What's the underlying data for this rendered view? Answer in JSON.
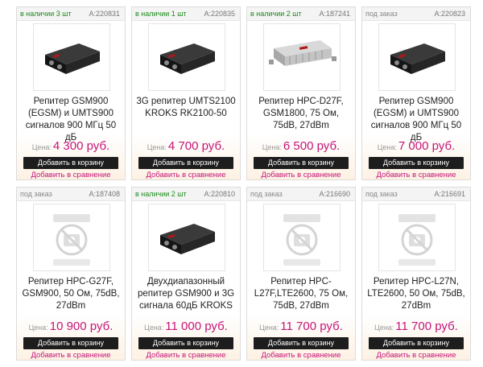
{
  "products": [
    {
      "stock": "в наличии 3 шт",
      "in_stock": true,
      "article": "A:220831",
      "title": "Репитер GSM900 (EGSM) и UMTS900 сигналов 900 МГц 50 дБ",
      "price_label": "Цена:",
      "price": "4 300 руб.",
      "cart": "Добавить в корзину",
      "compare": "Добавить в сравнение",
      "image": "black-repeater"
    },
    {
      "stock": "в наличии 1 шт",
      "in_stock": true,
      "article": "A:220835",
      "title": "3G репитер UMTS2100 KROKS RK2100-50",
      "price_label": "Цена:",
      "price": "4 700 руб.",
      "cart": "Добавить в корзину",
      "compare": "Добавить в сравнение",
      "image": "black-repeater"
    },
    {
      "stock": "в наличии 2 шт",
      "in_stock": true,
      "article": "A:187241",
      "title": "Репитер HPC-D27F, GSM1800, 75 Ом, 75dB, 27dBm",
      "price_label": "Цена:",
      "price": "6 500 руб.",
      "cart": "Добавить в корзину",
      "compare": "Добавить в сравнение",
      "image": "silver-repeater"
    },
    {
      "stock": "под заказ",
      "in_stock": false,
      "article": "A:220823",
      "title": "Репитер GSM900 (EGSM) и UMTS900 сигналов 900 МГц 50 дБ",
      "price_label": "Цена:",
      "price": "7 000 руб.",
      "cart": "Добавить в корзину",
      "compare": "Добавить в сравнение",
      "image": "black-repeater"
    },
    {
      "stock": "под заказ",
      "in_stock": false,
      "article": "A:187408",
      "title": "Репитер HPC-G27F, GSM900, 50 Ом, 75dB, 27dBm",
      "price_label": "Цена:",
      "price": "10 900 руб.",
      "cart": "Добавить в корзину",
      "compare": "Добавить в сравнение",
      "image": "no-photo"
    },
    {
      "stock": "в наличии 2 шт",
      "in_stock": true,
      "article": "A:220810",
      "title": "Двухдиапазонный репитер GSM900 и 3G сигнала 60дБ KROKS",
      "price_label": "Цена:",
      "price": "11 000 руб.",
      "cart": "Добавить в корзину",
      "compare": "Добавить в сравнение",
      "image": "black-repeater"
    },
    {
      "stock": "под заказ",
      "in_stock": false,
      "article": "A:216690",
      "title": "Репитер HPC-L27F,LTE2600, 75 Ом, 75dB, 27dBm",
      "price_label": "Цена:",
      "price": "11 700 руб.",
      "cart": "Добавить в корзину",
      "compare": "Добавить в сравнение",
      "image": "no-photo"
    },
    {
      "stock": "под заказ",
      "in_stock": false,
      "article": "A:216691",
      "title": "Репитер HPC-L27N, LTE2600, 50 Ом, 75dB, 27dBm",
      "price_label": "Цена:",
      "price": "11 700 руб.",
      "cart": "Добавить в корзину",
      "compare": "Добавить в сравнение",
      "image": "no-photo"
    }
  ],
  "colors": {
    "accent": "#c5157a",
    "in_stock": "#1e8a1e",
    "button": "#1d1d1d"
  }
}
